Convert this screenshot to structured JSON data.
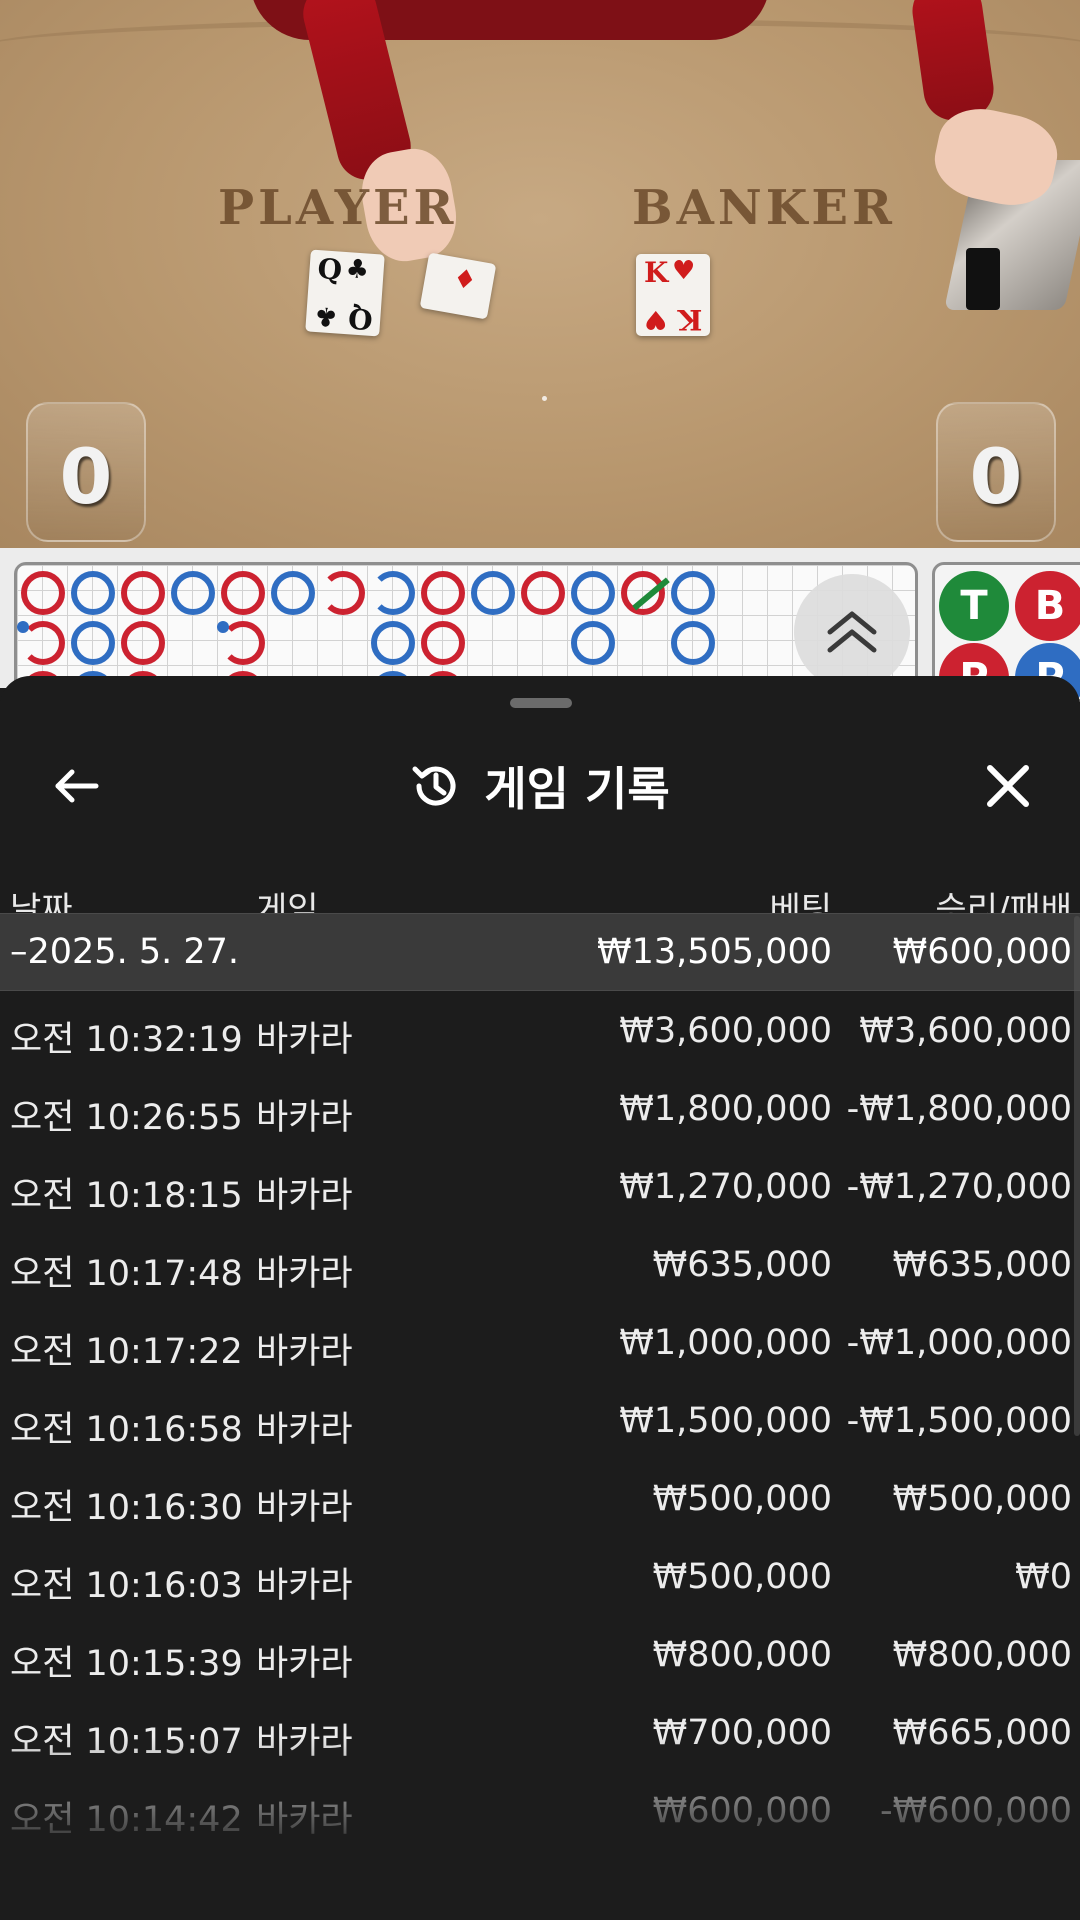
{
  "table": {
    "player_label": "PLAYER",
    "banker_label": "BANKER",
    "player_score": "0",
    "banker_score": "0",
    "cards": {
      "player_1": {
        "rank": "Q",
        "suit": "♣"
      },
      "player_2": {
        "rank": "",
        "suit": "♦"
      },
      "banker_1": {
        "rank": "K",
        "suit": "♥"
      }
    }
  },
  "road": {
    "stats": [
      "T",
      "B",
      "P",
      "P"
    ],
    "colors": {
      "banker": "#cc2230",
      "player": "#2f6dc2",
      "tie": "#1f8a3a"
    }
  },
  "history": {
    "title": "게임 기록",
    "columns": {
      "date": "날짜",
      "game": "게임",
      "bet": "베팅",
      "win_loss": "승리/패배"
    },
    "date_group": {
      "date": "–2025. 5. 27.",
      "bet_total": "₩13,505,000",
      "win_total": "₩600,000"
    },
    "rows": [
      {
        "time": "오전 10:32:19",
        "game": "바카라",
        "bet": "₩3,600,000",
        "result": "₩3,600,000"
      },
      {
        "time": "오전 10:26:55",
        "game": "바카라",
        "bet": "₩1,800,000",
        "result": "-₩1,800,000"
      },
      {
        "time": "오전 10:18:15",
        "game": "바카라",
        "bet": "₩1,270,000",
        "result": "-₩1,270,000"
      },
      {
        "time": "오전 10:17:48",
        "game": "바카라",
        "bet": "₩635,000",
        "result": "₩635,000"
      },
      {
        "time": "오전 10:17:22",
        "game": "바카라",
        "bet": "₩1,000,000",
        "result": "-₩1,000,000"
      },
      {
        "time": "오전 10:16:58",
        "game": "바카라",
        "bet": "₩1,500,000",
        "result": "-₩1,500,000"
      },
      {
        "time": "오전 10:16:30",
        "game": "바카라",
        "bet": "₩500,000",
        "result": "₩500,000"
      },
      {
        "time": "오전 10:16:03",
        "game": "바카라",
        "bet": "₩500,000",
        "result": "₩0"
      },
      {
        "time": "오전 10:15:39",
        "game": "바카라",
        "bet": "₩800,000",
        "result": "₩800,000"
      },
      {
        "time": "오전 10:15:07",
        "game": "바카라",
        "bet": "₩700,000",
        "result": "₩665,000"
      },
      {
        "time": "오전 10:14:42",
        "game": "바카라",
        "bet": "₩600,000",
        "result": "-₩600,000"
      }
    ]
  },
  "icons": {
    "back": "arrow-left-icon",
    "history": "history-clock-icon",
    "close": "close-icon",
    "expand": "double-chevron-up-icon"
  }
}
